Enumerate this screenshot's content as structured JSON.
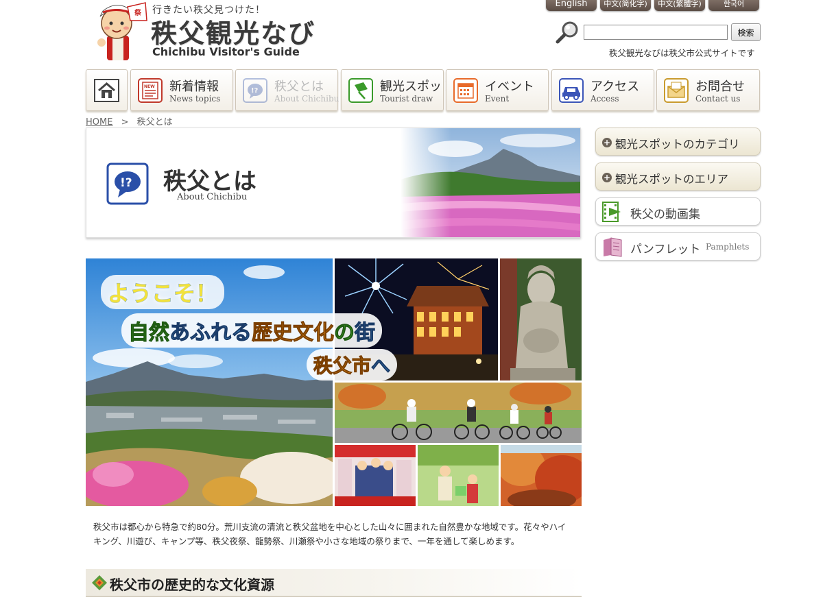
{
  "header": {
    "tagline": "行きたい秩父見つけた！",
    "site_title": "秩父観光なび",
    "site_subtitle": "Chichibu Visitor's Guide",
    "official_note": "秩父観光なびは秩父市公式サイトです"
  },
  "languages": [
    {
      "label": "English"
    },
    {
      "label": "中文(简化字)"
    },
    {
      "label": "中文(繁體字)"
    },
    {
      "label": "한국어"
    }
  ],
  "search": {
    "value": "",
    "placeholder": "",
    "button_label": "検索",
    "icon": "magnifier-icon"
  },
  "nav": {
    "home_icon": "home-icon",
    "items": [
      {
        "ja": "新着情報",
        "en": "News topics",
        "icon": "newspaper-icon",
        "color": "#c0392b"
      },
      {
        "ja": "秩父とは",
        "en": "About Chichibu",
        "icon": "question-bubble-icon",
        "color": "#2a4fa8",
        "active": true
      },
      {
        "ja": "観光スポット",
        "en": "Tourist draw",
        "icon": "flag-icon",
        "color": "#3a9a2a"
      },
      {
        "ja": "イベント",
        "en": "Event",
        "icon": "calendar-icon",
        "color": "#e86a2a"
      },
      {
        "ja": "アクセス",
        "en": "Access",
        "icon": "car-icon",
        "color": "#3b55b8"
      },
      {
        "ja": "お問合せ",
        "en": "Contact us",
        "icon": "mail-icon",
        "color": "#c99b2e"
      }
    ]
  },
  "breadcrumb": {
    "home": "HOME",
    "separator": ">",
    "current": "秩父とは"
  },
  "banner": {
    "title": "秩父とは",
    "subtitle": "About Chichibu",
    "icon": "question-bubble-icon"
  },
  "hero": {
    "line1": "ようこそ！",
    "line2": "自然あふれる歴史文化の街",
    "line3": "秩父市へ"
  },
  "intro": {
    "text": "秩父市は都心から特急で約80分。荒川支流の清流と秩父盆地を中心とした山々に囲まれた自然豊かな地域です。花々やハイキング、川遊び、キャンプ等、秩父夜祭、龍勢祭、川瀬祭や小さな地域の祭りまで、一年を通して楽しめます。"
  },
  "section": {
    "title": "秩父市の歴史的な文化資源"
  },
  "sidebar": {
    "items": [
      {
        "label": "観光スポットのカテゴリ",
        "icon": "plus-icon"
      },
      {
        "label": "観光スポットのエリア",
        "icon": "plus-icon"
      },
      {
        "label": "秩父の動画集",
        "icon": "film-icon"
      },
      {
        "label": "パンフレット",
        "label_en": "Pamphlets",
        "icon": "pamphlet-icon"
      }
    ]
  }
}
